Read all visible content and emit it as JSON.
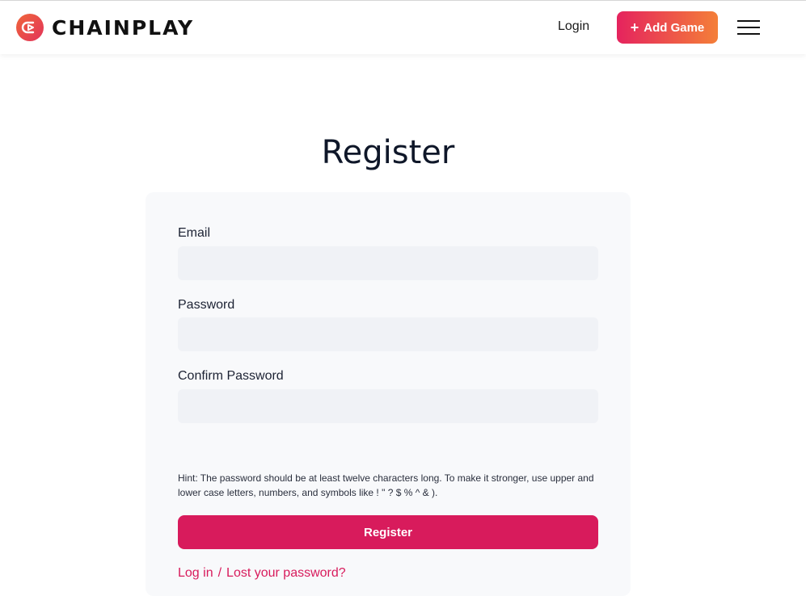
{
  "header": {
    "brand": "CHAINPLAY",
    "logo_icon": "chainplay-logo-icon",
    "login_label": "Login",
    "add_game_label": "Add Game",
    "menu_icon": "hamburger-menu-icon"
  },
  "page": {
    "title": "Register"
  },
  "form": {
    "email_label": "Email",
    "email_value": "",
    "password_label": "Password",
    "password_value": "",
    "confirm_label": "Confirm Password",
    "confirm_value": "",
    "hint": "Hint: The password should be at least twelve characters long. To make it stronger, use upper and lower case letters, numbers, and symbols like ! \" ? $ % ^ & ).",
    "register_label": "Register"
  },
  "footer_links": {
    "login": "Log in",
    "separator": "/",
    "lost_password": "Lost your password?"
  },
  "colors": {
    "accent": "#d81b5c",
    "gradient_start": "#e5235e",
    "gradient_end": "#f47f38",
    "input_bg": "#f0f2f6",
    "card_bg": "#f8f9fb"
  }
}
